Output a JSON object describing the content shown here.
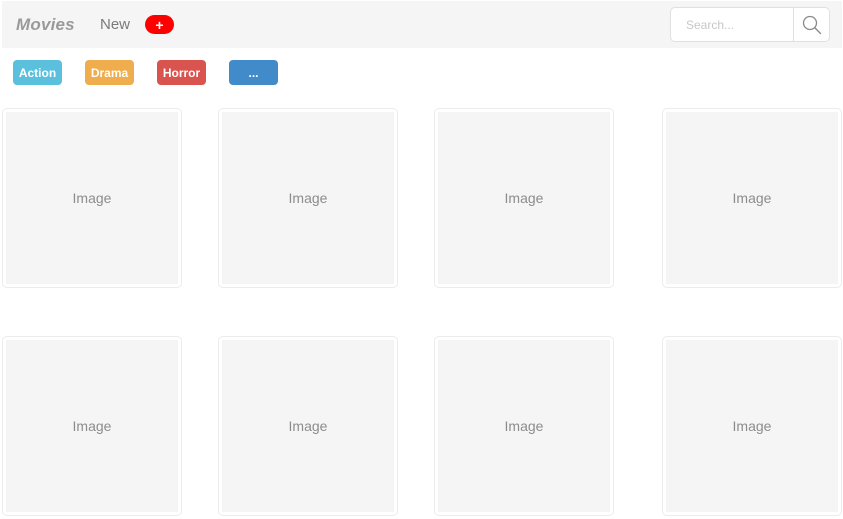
{
  "navbar": {
    "brand": "Movies",
    "new_label": "New",
    "add_label": "+",
    "search": {
      "placeholder": "Search...",
      "icon": "search-icon"
    }
  },
  "genres": [
    {
      "label": "Action",
      "color": "#5bc0de"
    },
    {
      "label": "Drama",
      "color": "#f0ad4e"
    },
    {
      "label": "Horror",
      "color": "#d9534f"
    },
    {
      "label": "...",
      "color": "#428bca"
    }
  ],
  "movies": [
    {
      "image_label": "Image"
    },
    {
      "image_label": "Image"
    },
    {
      "image_label": "Image"
    },
    {
      "image_label": "Image"
    },
    {
      "image_label": "Image"
    },
    {
      "image_label": "Image"
    },
    {
      "image_label": "Image"
    },
    {
      "image_label": "Image"
    }
  ]
}
